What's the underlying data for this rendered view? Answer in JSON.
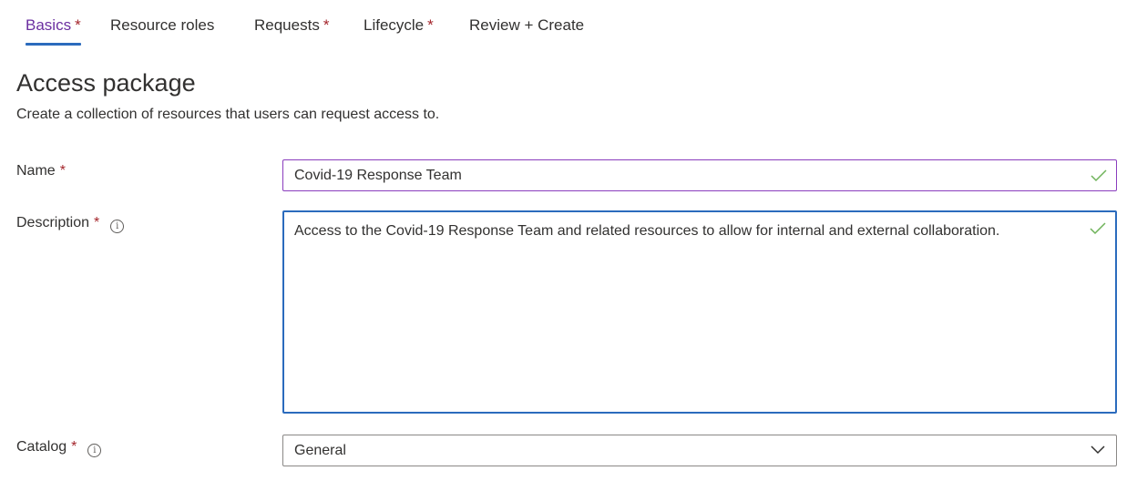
{
  "tabs": [
    {
      "label": "Basics",
      "required": "*"
    },
    {
      "label": "Resource roles",
      "required": ""
    },
    {
      "label": "Requests",
      "required": "*"
    },
    {
      "label": "Lifecycle",
      "required": "*"
    },
    {
      "label": "Review + Create",
      "required": ""
    }
  ],
  "page": {
    "title": "Access package",
    "subtitle": "Create a collection of resources that users can request access to."
  },
  "form": {
    "name": {
      "label": "Name",
      "required": "*",
      "value": "Covid-19 Response Team"
    },
    "description": {
      "label": "Description",
      "required": "*",
      "value": "Access to the Covid-19 Response Team and related resources to allow for internal and external collaboration."
    },
    "catalog": {
      "label": "Catalog",
      "required": "*",
      "value": "General"
    }
  },
  "colors": {
    "active_tab_text": "#6b2fa0",
    "active_tab_underline": "#2b6bbd",
    "required_asterisk": "#a4262c",
    "valid_check": "#6fb35a",
    "focus_border": "#2b6bbd"
  },
  "icons": {
    "info": "info-icon",
    "valid": "checkmark-icon",
    "dropdown": "chevron-down-icon"
  }
}
